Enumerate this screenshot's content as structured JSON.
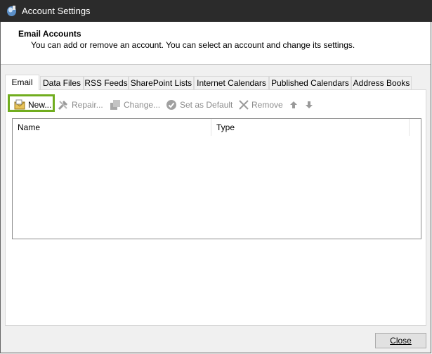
{
  "window": {
    "title": "Account Settings",
    "icon": "outlook-settings-icon"
  },
  "header": {
    "heading": "Email Accounts",
    "description": "You can add or remove an account. You can select an account and change its settings."
  },
  "tabs": [
    {
      "label": "Email",
      "active": true
    },
    {
      "label": "Data Files"
    },
    {
      "label": "RSS Feeds"
    },
    {
      "label": "SharePoint Lists"
    },
    {
      "label": "Internet Calendars"
    },
    {
      "label": "Published Calendars"
    },
    {
      "label": "Address Books"
    }
  ],
  "toolbar": {
    "new_label": "New...",
    "repair_label": "Repair...",
    "change_label": "Change...",
    "set_default_label": "Set as Default",
    "remove_label": "Remove",
    "move_up_icon": "arrow-up-icon",
    "move_down_icon": "arrow-down-icon"
  },
  "list": {
    "columns": [
      "Name",
      "Type"
    ],
    "rows": []
  },
  "footer": {
    "close_label": "Close"
  },
  "colors": {
    "titlebar": "#2b2b2b",
    "highlight": "#71ad1f",
    "disabled_text": "#8c8c8c"
  }
}
